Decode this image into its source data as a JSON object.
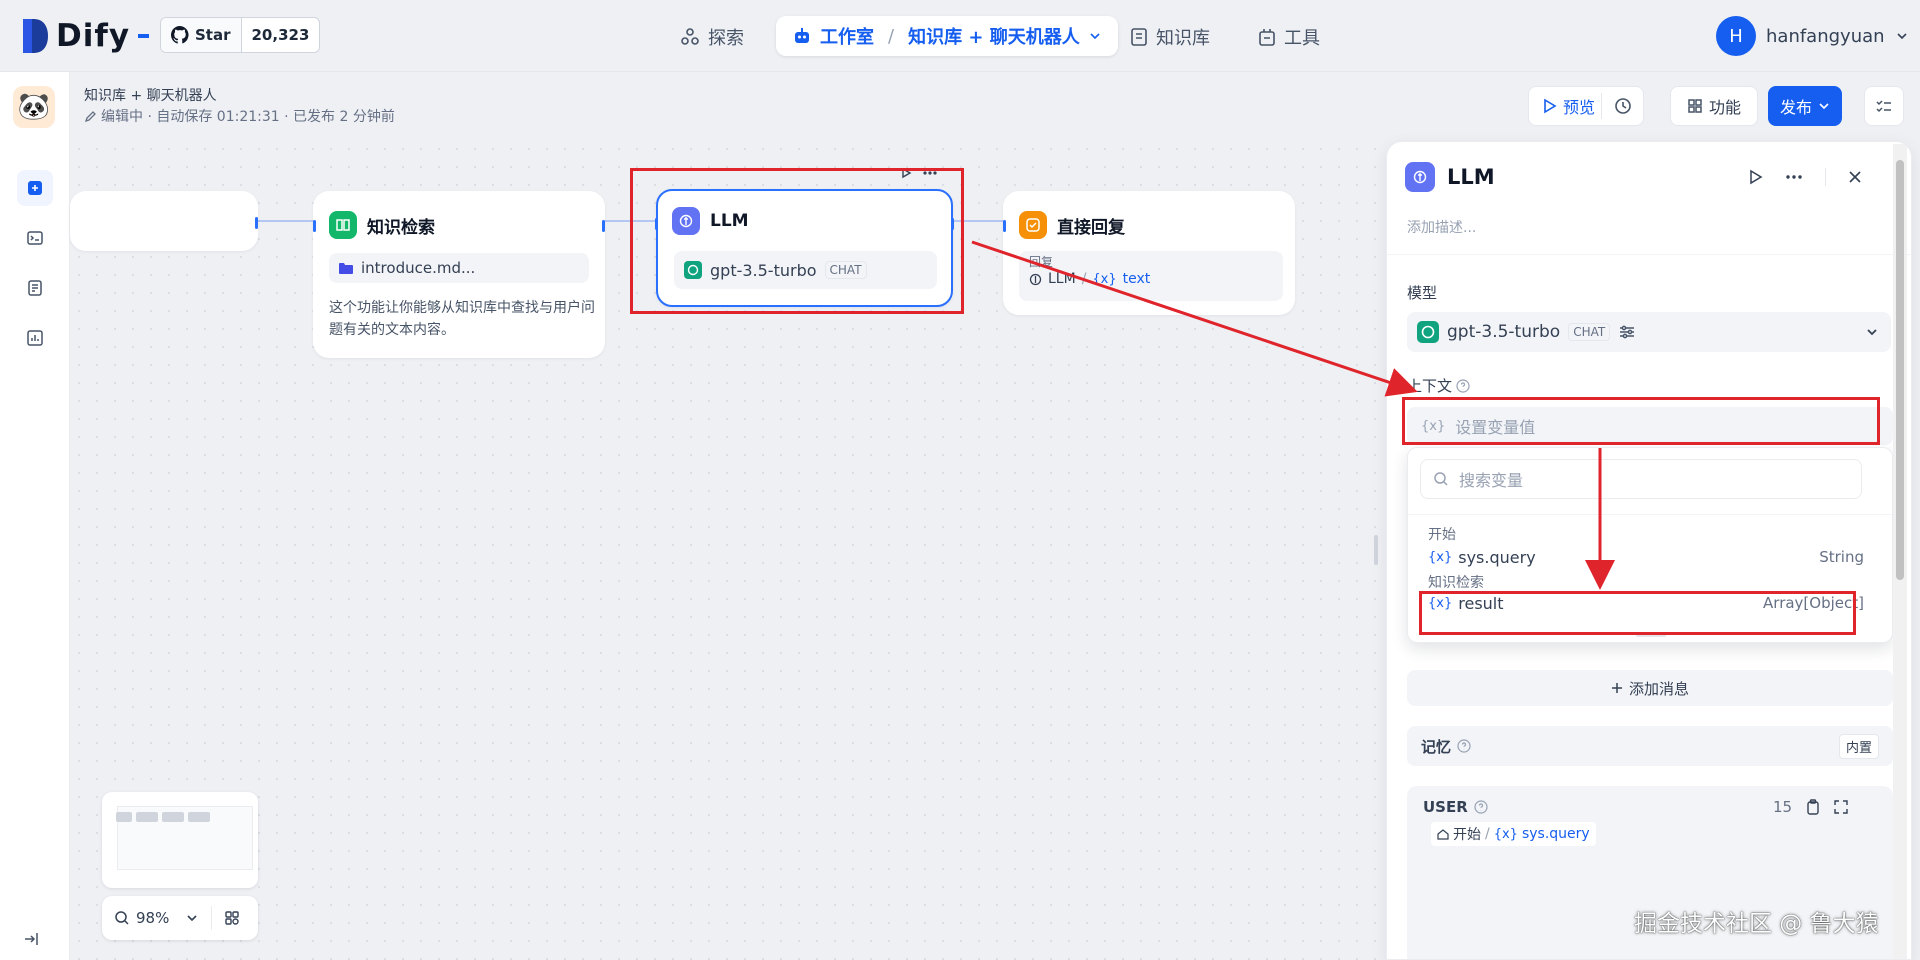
{
  "nav": {
    "logo": "Dify",
    "github": {
      "star_label": "Star",
      "star_count": "20,323"
    },
    "items": [
      {
        "label": "探索"
      },
      {
        "label": "工作室"
      },
      {
        "label": "知识库"
      },
      {
        "label": "工具"
      }
    ],
    "studio_app": "知识库 + 聊天机器人",
    "user": {
      "initial": "H",
      "name": "hanfangyuan"
    }
  },
  "header": {
    "app_title": "知识库 + 聊天机器人",
    "status": "编辑中 · 自动保存 01:21:31 · 已发布 2 分钟前",
    "preview_label": "预览",
    "features_label": "功能",
    "publish_label": "发布"
  },
  "canvas": {
    "kr_node": {
      "title": "知识检索",
      "file": "introduce.md...",
      "desc": "这个功能让你能够从知识库中查找与用户问题有关的文本内容。"
    },
    "llm_node": {
      "title": "LLM",
      "model": "gpt-3.5-turbo",
      "badge": "CHAT"
    },
    "answer_node": {
      "title": "直接回复",
      "label": "回复",
      "var_node": "LLM",
      "var_name": "text"
    },
    "zoom": "98%"
  },
  "panel": {
    "title": "LLM",
    "desc_placeholder": "添加描述...",
    "model_label": "模型",
    "model_name": "gpt-3.5-turbo",
    "model_badge": "CHAT",
    "context_label": "上下文",
    "context_placeholder": "设置变量值",
    "search_placeholder": "搜索变量",
    "groups": [
      {
        "name": "开始",
        "items": [
          {
            "name": "sys.query",
            "type": "String"
          }
        ]
      },
      {
        "name": "知识检索",
        "items": [
          {
            "name": "result",
            "type": "Array[Object]"
          }
        ]
      }
    ],
    "add_message": "添加消息",
    "memory_label": "记忆",
    "memory_badge": "内置",
    "user_role": "USER",
    "user_count": "15",
    "user_var_node": "开始",
    "user_var_name": "sys.query"
  },
  "watermark": "掘金技术社区 @ 鲁大猿",
  "colors": {
    "accent": "#155eef",
    "annotation": "#e0242b",
    "kr_icon": "#12b76a",
    "answer_icon": "#f79009",
    "llm_icon": "#6172f3"
  }
}
